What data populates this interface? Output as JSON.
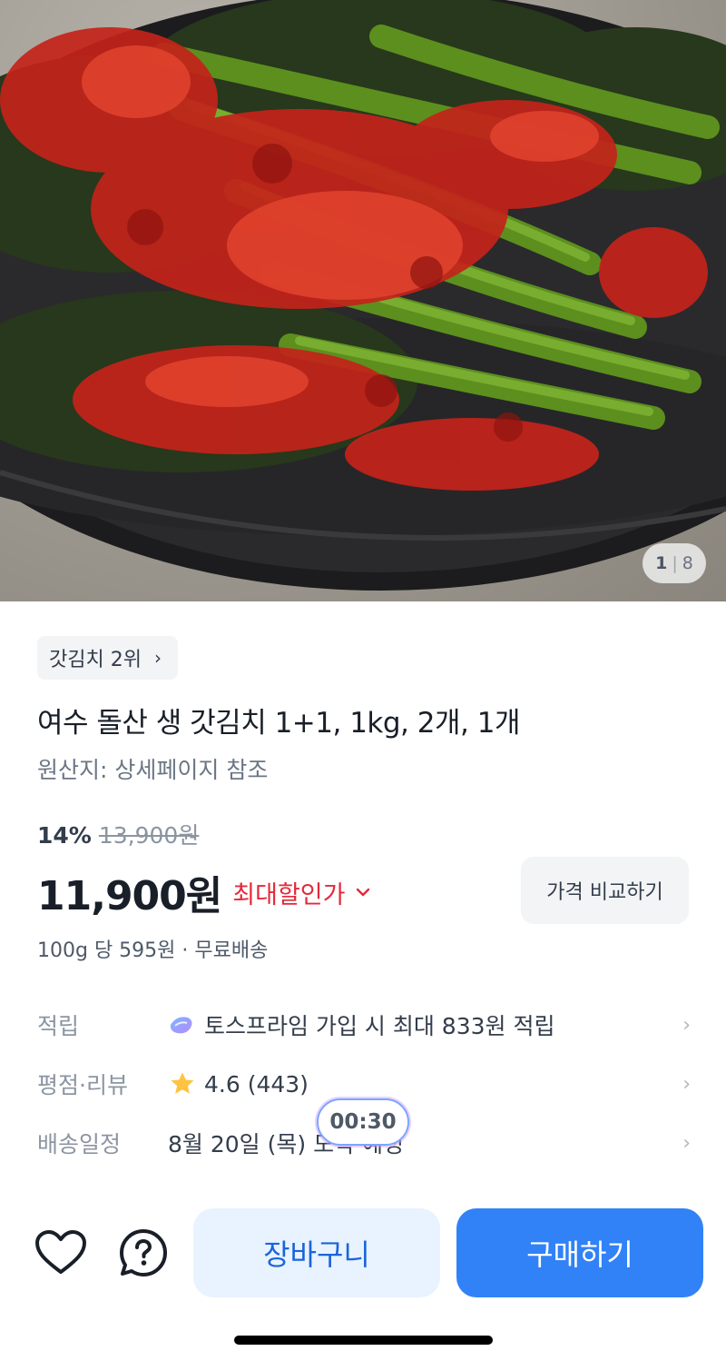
{
  "image": {
    "counter_current": "1",
    "counter_separator": "|",
    "counter_total": "8"
  },
  "product": {
    "rank_badge": "갓김치 2위",
    "title": "여수 돌산 생 갓김치 1+1, 1kg, 2개, 1개",
    "origin": "원산지: 상세페이지 참조",
    "discount_percent": "14%",
    "original_price": "13,900원",
    "price": "11,900원",
    "max_discount_label": "최대할인가",
    "compare_button": "가격 비교하기",
    "unit_price": "100g 당 595원 · 무료배송"
  },
  "info_rows": [
    {
      "label": "적립",
      "value": "토스프라임 가입 시 최대 833원 적립"
    },
    {
      "label": "평점·리뷰",
      "value": "4.6 (443)"
    },
    {
      "label": "배송일정",
      "value": "8월 20일 (목) 도착 예정"
    }
  ],
  "timer": "00:30",
  "actions": {
    "cart": "장바구니",
    "buy": "구매하기"
  },
  "colors": {
    "accent_blue": "#3182f6",
    "discount_red": "#e42939",
    "star": "#ffc342"
  },
  "icons": {
    "chevron": "›",
    "dropdown": "⌄"
  }
}
